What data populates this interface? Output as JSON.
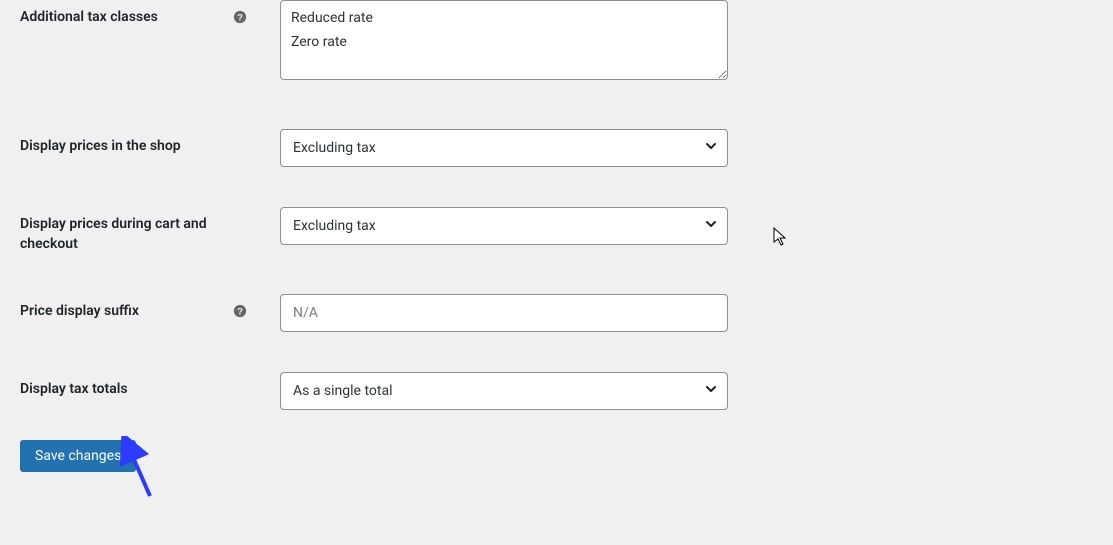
{
  "fields": {
    "additional_tax_classes": {
      "label": "Additional tax classes",
      "value": "Reduced rate\nZero rate",
      "help": true
    },
    "display_prices_shop": {
      "label": "Display prices in the shop",
      "value": "Excluding tax"
    },
    "display_prices_cart": {
      "label": "Display prices during cart and checkout",
      "value": "Excluding tax"
    },
    "price_display_suffix": {
      "label": "Price display suffix",
      "placeholder": "N/A",
      "value": "",
      "help": true
    },
    "display_tax_totals": {
      "label": "Display tax totals",
      "value": "As a single total"
    }
  },
  "actions": {
    "save": "Save changes"
  }
}
